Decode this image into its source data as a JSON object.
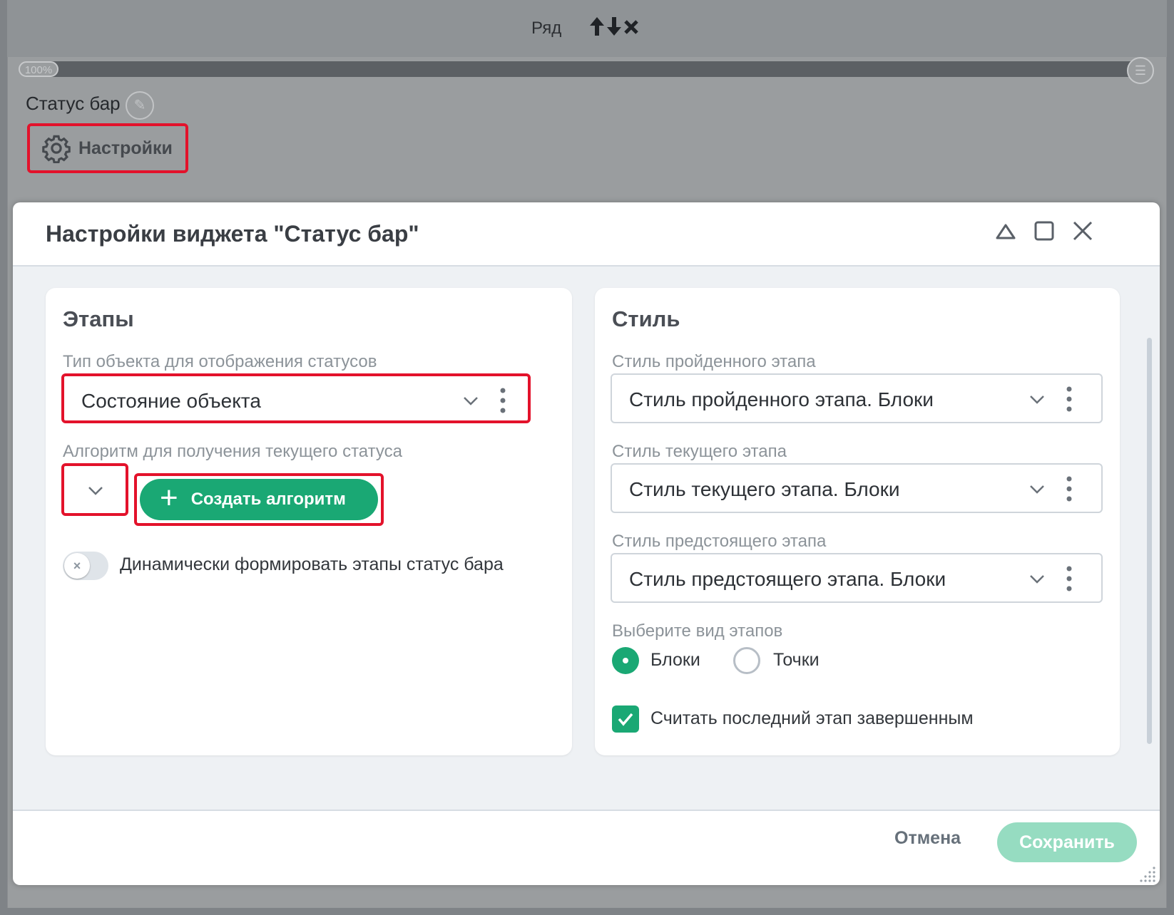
{
  "background": {
    "row_title": "Ряд",
    "row_controls": [
      "🡅",
      "🡇",
      "✖"
    ],
    "progress_percent": 100,
    "progress_label": "100%",
    "widget_name": "Статус бар",
    "settings_label": "Настройки"
  },
  "dialog": {
    "title": "Настройки виджета \"Статус бар\"",
    "left_panel": {
      "title": "Этапы",
      "object_type_label": "Тип объекта для отображения статусов",
      "object_type_value": "Состояние объекта",
      "algorithm_label": "Алгоритм для получения текущего статуса",
      "algorithm_value": "",
      "create_algorithm_label": "Создать алгоритм",
      "dynamic_toggle_label": "Динамически формировать этапы статус бара",
      "dynamic_toggle_on": false
    },
    "right_panel": {
      "title": "Стиль",
      "passed_label": "Стиль пройденного этапа",
      "passed_value": "Стиль пройденного этапа. Блоки",
      "current_label": "Стиль текущего этапа",
      "current_value": "Стиль текущего этапа. Блоки",
      "upcoming_label": "Стиль предстоящего этапа",
      "upcoming_value": "Стиль предстоящего этапа. Блоки",
      "view_label": "Выберите вид этапов",
      "view_options": [
        "Блоки",
        "Точки"
      ],
      "view_selected": "Блоки",
      "last_complete_label": "Считать последний этап завершенным",
      "last_complete_checked": true
    },
    "footer": {
      "cancel_label": "Отмена",
      "save_label": "Сохранить"
    }
  },
  "colors": {
    "accent": "#1aa874",
    "highlight": "#e3122b",
    "save_disabled": "#96dcc1"
  }
}
